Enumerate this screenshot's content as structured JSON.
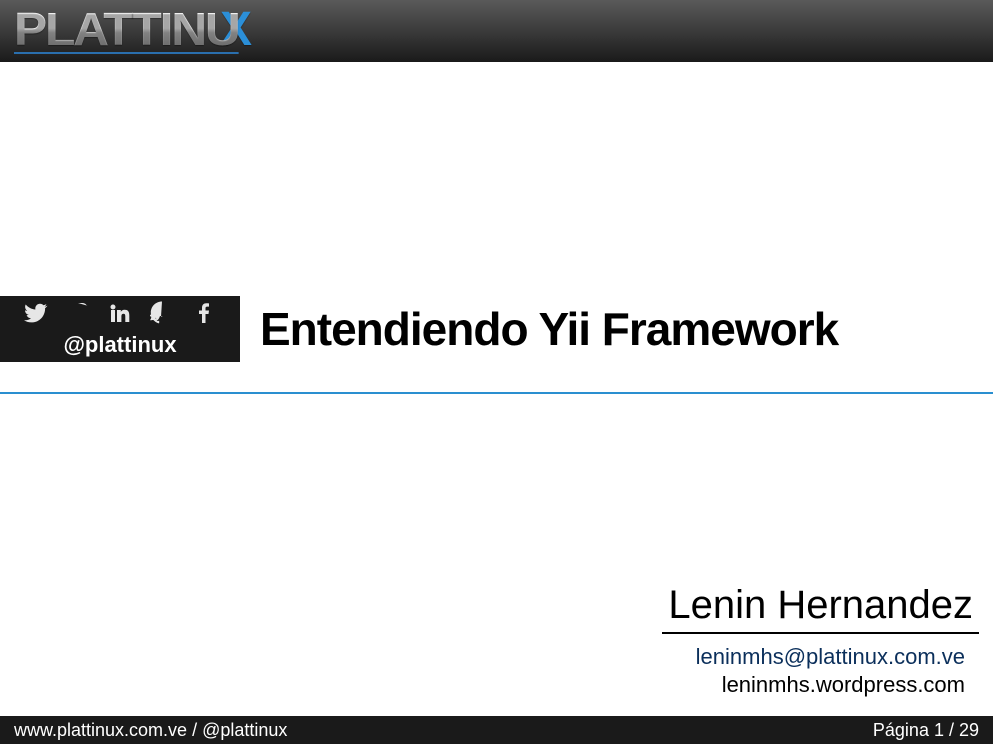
{
  "brand": {
    "name": "PLATTINU",
    "accent": "X"
  },
  "social": {
    "handle": "@plattinux"
  },
  "title": "Entendiendo Yii Framework",
  "author": {
    "name": "Lenin Hernandez",
    "email": "leninmhs@plattinux.com.ve",
    "site": "leninmhs.wordpress.com"
  },
  "footer": {
    "website": "www.plattinux.com.ve",
    "separator": " / ",
    "handle": "@plattinux",
    "page_label": "Página 1 / 29"
  }
}
